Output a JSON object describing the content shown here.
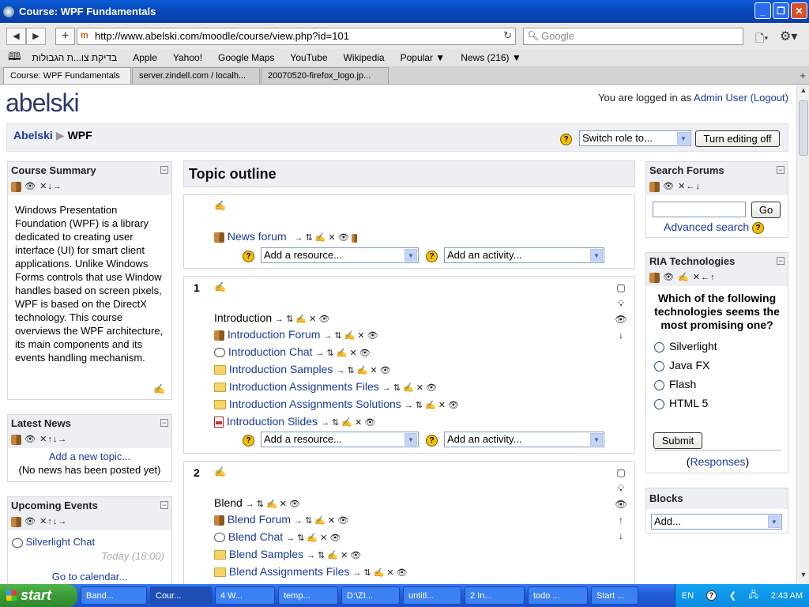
{
  "window": {
    "title": "Course: WPF Fundamentals"
  },
  "toolbar": {
    "url": "http://www.abelski.com/moodle/course/view.php?id=101",
    "search_placeholder": "Google"
  },
  "bookmarks": [
    "בדיקת צו...ת הגבולות",
    "Apple",
    "Yahoo!",
    "Google Maps",
    "YouTube",
    "Wikipedia",
    "Popular ▼",
    "News (216) ▼"
  ],
  "tabs": [
    "Course: WPF Fundamentals",
    "server.zindell.com / localh...",
    "20070520-firefox_logo.jp..."
  ],
  "header": {
    "site": "abelski",
    "logged_prefix": "You are logged in as ",
    "user": "Admin User",
    "logout": "(Logout)"
  },
  "breadcrumb": {
    "home": "Abelski",
    "current": "WPF"
  },
  "nav": {
    "switch_role": "Switch role to...",
    "editing": "Turn editing off"
  },
  "course_summary": {
    "title": "Course Summary",
    "text": "Windows Presentation Foundation (WPF) is a library dedicated to creating user interface (UI) for smart client applications. Unlike Windows Forms controls that use Window handles based on screen pixels, WPF is based on the DirectX technology. This course overviews the WPF architecture, its main components and its events handling mechanism."
  },
  "latest_news": {
    "title": "Latest News",
    "add": "Add a new topic...",
    "empty": "(No news has been posted yet)"
  },
  "upcoming": {
    "title": "Upcoming Events",
    "event": "Silverlight Chat",
    "time": "Today (18:00)",
    "goto": "Go to calendar..."
  },
  "topic": {
    "title": "Topic outline",
    "add_resource": "Add a resource...",
    "add_activity": "Add an activity..."
  },
  "section0": {
    "forum": "News forum"
  },
  "section1": {
    "num": "1",
    "label": "Introduction",
    "items": [
      "Introduction Forum",
      "Introduction Chat",
      "Introduction Samples",
      "Introduction Assignments Files",
      "Introduction Assignments Solutions",
      "Introduction Slides"
    ]
  },
  "section2": {
    "num": "2",
    "label": "Blend",
    "items": [
      "Blend Forum",
      "Blend Chat",
      "Blend Samples",
      "Blend Assignments Files"
    ]
  },
  "search_forums": {
    "title": "Search Forums",
    "go": "Go",
    "advanced": "Advanced search"
  },
  "ria": {
    "title": "RIA Technologies",
    "question": "Which of the following technologies seems the most promising one?",
    "options": [
      "Silverlight",
      "Java FX",
      "Flash",
      "HTML 5"
    ],
    "submit": "Submit",
    "responses": "Responses"
  },
  "blocks": {
    "title": "Blocks",
    "add": "Add..."
  },
  "taskbar": {
    "start": "start",
    "items": [
      "Band...",
      "Cour...",
      "4 W...",
      "temp...",
      "D:\\ZI...",
      "untitl...",
      "2 In...",
      "todo ...",
      "Start ..."
    ],
    "lang": "EN",
    "time": "2:43 AM"
  }
}
